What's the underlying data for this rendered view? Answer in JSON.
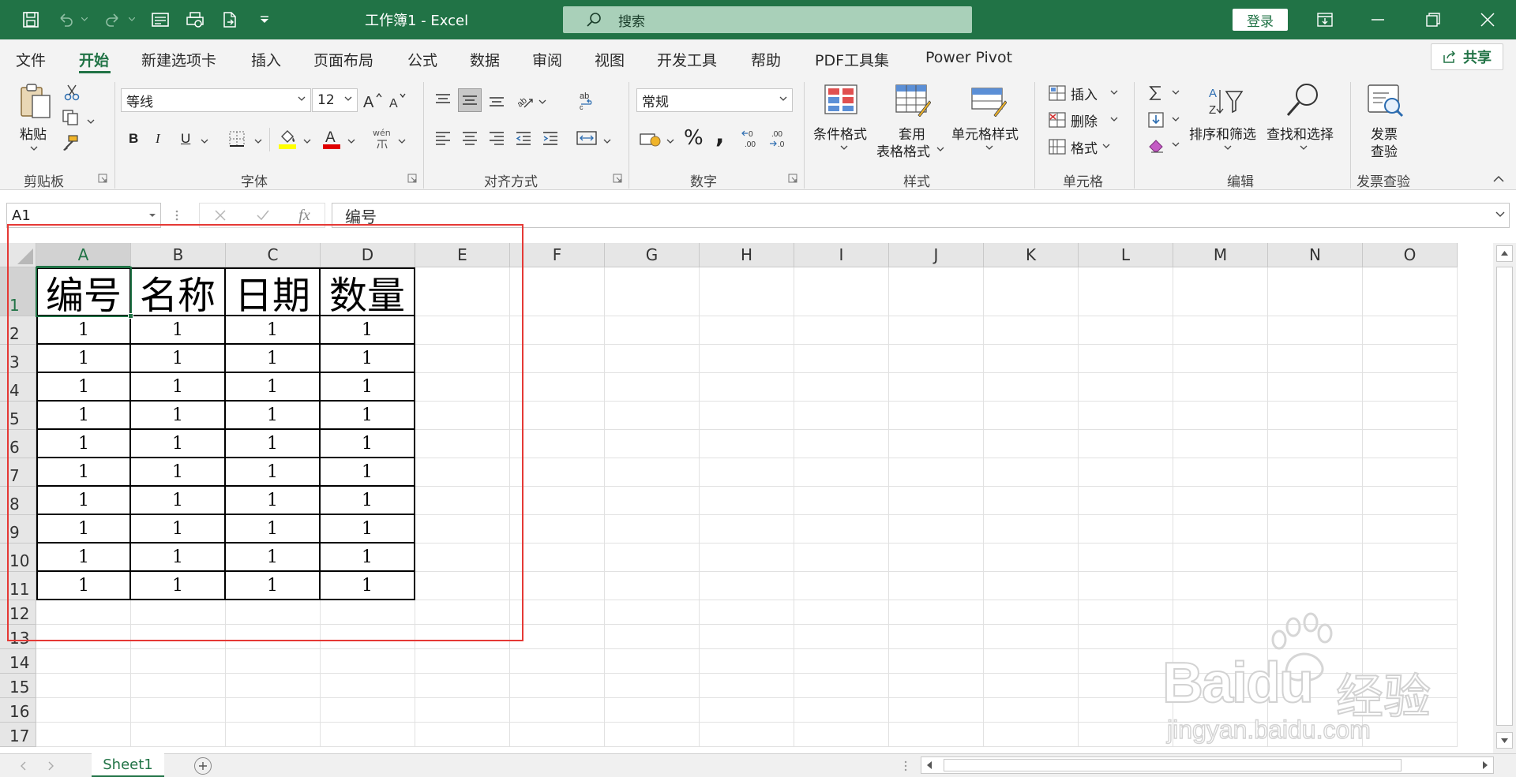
{
  "titlebar": {
    "doc_title": "工作簿1  -  Excel",
    "search_placeholder": "搜索",
    "login_label": "登录"
  },
  "menu": {
    "tabs": [
      "文件",
      "开始",
      "新建选项卡",
      "插入",
      "页面布局",
      "公式",
      "数据",
      "审阅",
      "视图",
      "开发工具",
      "帮助",
      "PDF工具集",
      "Power Pivot"
    ],
    "active": "开始",
    "share_label": "共享"
  },
  "ribbon": {
    "clipboard": {
      "paste_label": "粘贴",
      "group_label": "剪贴板"
    },
    "font": {
      "font_name": "等线",
      "font_size": "12",
      "bold": "B",
      "italic": "I",
      "underline": "U",
      "phonetic": "wén",
      "group_label": "字体"
    },
    "alignment": {
      "group_label": "对齐方式"
    },
    "number": {
      "format": "常规",
      "percent": "%",
      "comma": ",",
      "group_label": "数字"
    },
    "styles": {
      "conditional": "条件格式",
      "table_format_1": "套用",
      "table_format_2": "表格格式",
      "cell_styles": "单元格样式",
      "group_label": "样式"
    },
    "cells": {
      "insert": "插入",
      "delete": "删除",
      "format": "格式",
      "group_label": "单元格"
    },
    "editing": {
      "sort_filter": "排序和筛选",
      "find_select": "查找和选择",
      "group_label": "编辑"
    },
    "invoice": {
      "label_1": "发票",
      "label_2": "查验",
      "group_label": "发票查验"
    }
  },
  "formula_bar": {
    "name_box": "A1",
    "fx": "fx",
    "value": "编号"
  },
  "sheet": {
    "columns": [
      "A",
      "B",
      "C",
      "D",
      "E",
      "F",
      "G",
      "H",
      "I",
      "J",
      "K",
      "L",
      "M",
      "N",
      "O"
    ],
    "rows": [
      "1",
      "2",
      "3",
      "4",
      "5",
      "6",
      "7",
      "8",
      "9",
      "10",
      "11",
      "12",
      "13",
      "14",
      "15",
      "16",
      "17"
    ],
    "header_row": [
      "编号",
      "名称",
      "日期",
      "数量"
    ],
    "data_rows": [
      [
        "1",
        "1",
        "1",
        "1"
      ],
      [
        "1",
        "1",
        "1",
        "1"
      ],
      [
        "1",
        "1",
        "1",
        "1"
      ],
      [
        "1",
        "1",
        "1",
        "1"
      ],
      [
        "1",
        "1",
        "1",
        "1"
      ],
      [
        "1",
        "1",
        "1",
        "1"
      ],
      [
        "1",
        "1",
        "1",
        "1"
      ],
      [
        "1",
        "1",
        "1",
        "1"
      ],
      [
        "1",
        "1",
        "1",
        "1"
      ],
      [
        "1",
        "1",
        "1",
        "1"
      ]
    ],
    "active_cell": "A1",
    "tab_name": "Sheet1"
  },
  "watermark": {
    "brand": "Baidu",
    "sub_brand": "经验",
    "url": "jingyan.baidu.com"
  },
  "colors": {
    "accent": "#217346",
    "highlight_box": "#e53935"
  }
}
